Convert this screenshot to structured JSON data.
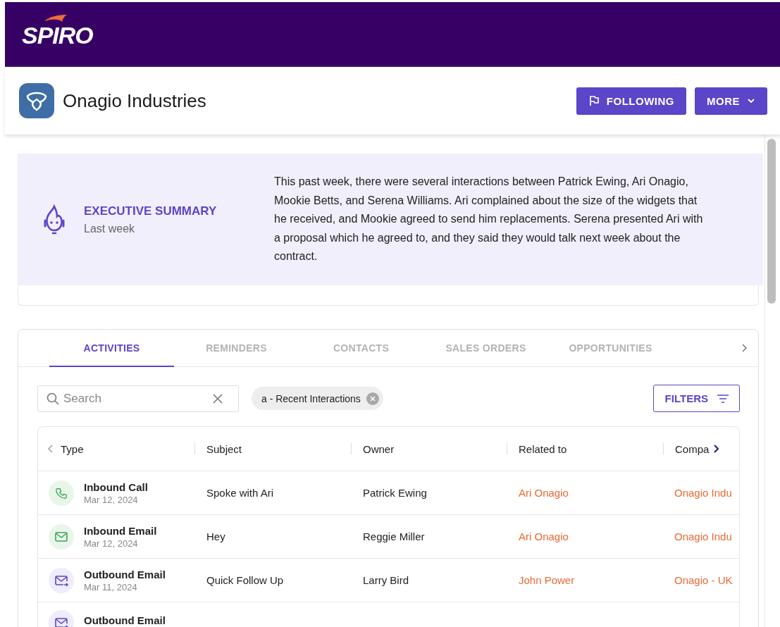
{
  "app": {
    "logo": "SPIRO"
  },
  "record": {
    "title": "Onagio Industries",
    "buttons": [
      {
        "label": "FOLLOWING",
        "kind": "follow"
      },
      {
        "label": "MORE",
        "kind": "menu"
      }
    ]
  },
  "summary": {
    "title": "EXECUTIVE SUMMARY",
    "period": "Last week",
    "text": "This past week, there were several interactions between Patrick Ewing, Ari Onagio, Mookie Betts, and Serena Williams. Ari complained about the size of the widgets that he received, and Mookie agreed to send him replacements. Serena presented Ari with a proposal which he agreed to, and they said they would talk next week about the contract."
  },
  "tabs": [
    {
      "label": "ACTIVITIES",
      "selected": true
    },
    {
      "label": "REMINDERS",
      "selected": false
    },
    {
      "label": "CONTACTS",
      "selected": false
    },
    {
      "label": "SALES ORDERS",
      "selected": false
    },
    {
      "label": "OPPORTUNITIES",
      "selected": false
    }
  ],
  "search": {
    "placeholder": "Search"
  },
  "filter_chip": "a - Recent Interactions",
  "filters_button": "FILTERS",
  "table": {
    "columns": [
      "Type",
      "Subject",
      "Owner",
      "Related to",
      "Compa"
    ],
    "rows": [
      {
        "kind": "call",
        "type": "Inbound Call",
        "date": "Mar 12, 2024",
        "subject": "Spoke with Ari",
        "owner": "Patrick Ewing",
        "related": "Ari Onagio",
        "company": "Onagio Indu"
      },
      {
        "kind": "inbound-email",
        "type": "Inbound Email",
        "date": "Mar 12, 2024",
        "subject": "Hey",
        "owner": "Reggie Miller",
        "related": "Ari Onagio",
        "company": "Onagio Indu"
      },
      {
        "kind": "outbound-email",
        "type": "Outbound Email",
        "date": "Mar 11, 2024",
        "subject": "Quick Follow Up",
        "owner": "Larry Bird",
        "related": "John Power",
        "company": "Onagio - UK"
      },
      {
        "kind": "outbound-email",
        "type": "Outbound Email"
      }
    ]
  }
}
